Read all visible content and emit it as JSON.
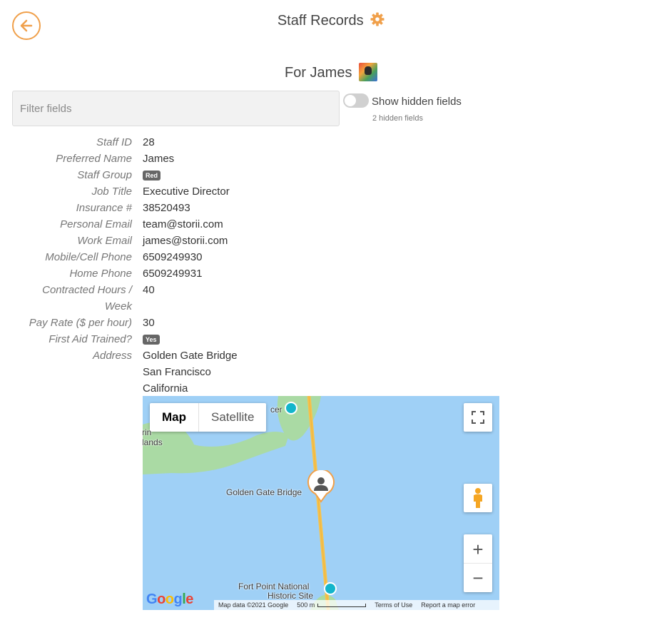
{
  "header": {
    "title": "Staff Records",
    "subtitle": "For James",
    "accent_color": "#f0a04b"
  },
  "filter": {
    "placeholder": "Filter fields"
  },
  "hidden_fields": {
    "toggle_label": "Show hidden fields",
    "count_text": "2 hidden fields",
    "enabled": false
  },
  "fields": [
    {
      "label": "Staff ID",
      "value": "28"
    },
    {
      "label": "Preferred Name",
      "value": "James"
    },
    {
      "label": "Staff Group",
      "value": "Red"
    },
    {
      "label": "Job Title",
      "value": "Executive Director"
    },
    {
      "label": "Insurance #",
      "value": "38520493"
    },
    {
      "label": "Personal Email",
      "value": "team@storii.com"
    },
    {
      "label": "Work Email",
      "value": "james@storii.com"
    },
    {
      "label": "Mobile/Cell Phone",
      "value": "6509249930"
    },
    {
      "label": "Home Phone",
      "value": "6509249931"
    },
    {
      "label": "Contracted Hours /",
      "label2": "Week",
      "value": "40"
    },
    {
      "label": "Pay Rate ($ per hour)",
      "value": "30"
    },
    {
      "label": "First Aid Trained?",
      "value": "Yes"
    },
    {
      "label": "Address",
      "value": "Golden Gate Bridge",
      "value2": "San Francisco",
      "value3": "California"
    }
  ],
  "map": {
    "type_buttons": [
      "Map",
      "Satellite"
    ],
    "active_type": "Map",
    "labels": {
      "area_1": "rin",
      "area_2": "lands",
      "poi_1": "cer",
      "bridge": "Golden Gate Bridge",
      "site_1": "Fort Point National",
      "site_2": "Historic Site"
    },
    "footer": {
      "map_data": "Map data ©2021 Google",
      "scale": "500 m",
      "terms": "Terms of Use",
      "report": "Report a map error"
    },
    "logo": "Google",
    "zoom_in": "+",
    "zoom_out": "−",
    "water_color": "#9fd0f6",
    "land_color": "#aadaa4",
    "road_color": "#f6c34d"
  }
}
